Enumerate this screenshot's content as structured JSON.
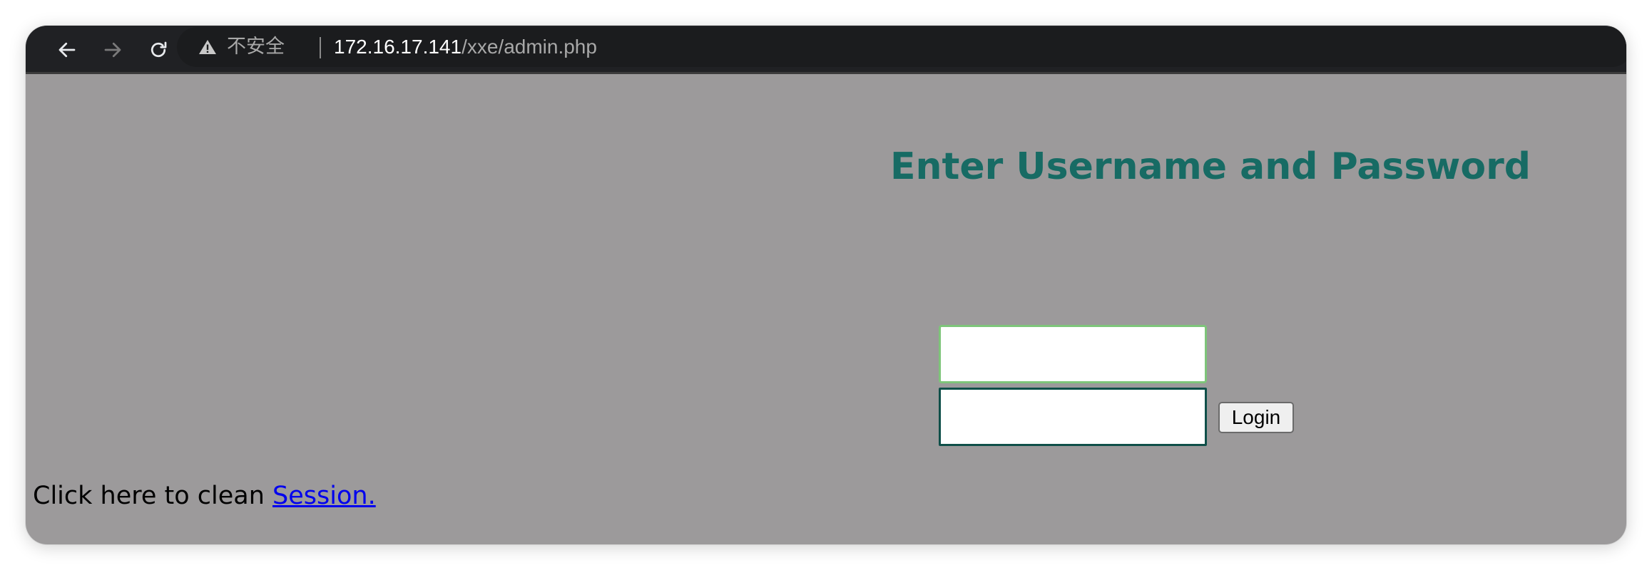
{
  "browser": {
    "security_label": "不安全",
    "url_host": "172.16.17.141",
    "url_path": "/xxe/admin.php"
  },
  "page": {
    "heading": "Enter Username and Password",
    "username_value": "",
    "password_value": "",
    "login_label": "Login",
    "session_prefix": "Click here to clean ",
    "session_link": "Session."
  },
  "colors": {
    "page_background": "#9c9a9b",
    "heading": "#176b64",
    "link": "#0000ee",
    "toolbar": "#202124"
  }
}
